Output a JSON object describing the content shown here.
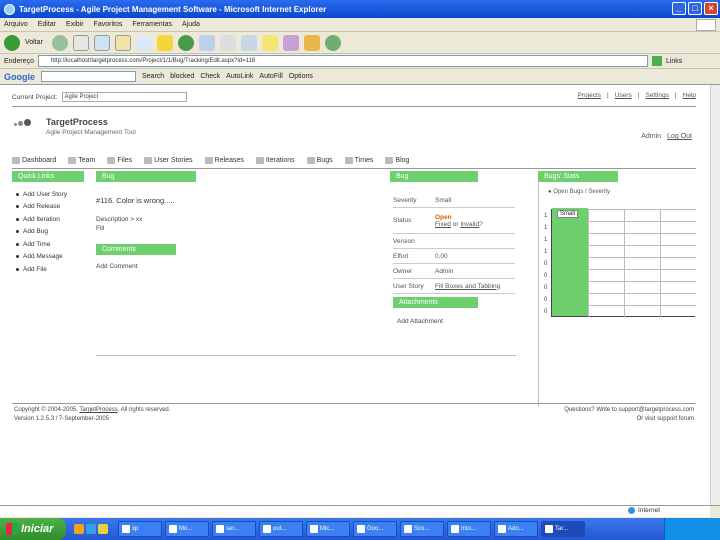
{
  "window": {
    "title": "TargetProcess - Agile Project Management Software - Microsoft Internet Explorer"
  },
  "menu": [
    "Arquivo",
    "Editar",
    "Exibir",
    "Favoritos",
    "Ferramentas",
    "Ajuda"
  ],
  "toolbar": {
    "back_label": "Voltar"
  },
  "address": {
    "label": "Endereço",
    "url": "http://localhost/targetprocess.com/Project/1/1/Bug/Tracking/Edit.aspx?id=116",
    "links_label": "Links"
  },
  "google": {
    "logo": "Google",
    "search_label": "Search",
    "popups_label": "blocked",
    "check_label": "Check",
    "autolink_label": "AutoLink",
    "autofill_label": "AutoFill",
    "options_label": "Options"
  },
  "project_bar": {
    "label": "Current Project:",
    "selected": "Agile Project"
  },
  "top_links": [
    "Projects",
    "Users",
    "Settings",
    "Help"
  ],
  "logo": {
    "name": "TargetProcess",
    "tagline": "Agile Project Management Tool"
  },
  "user": {
    "name": "Admin",
    "logout": "Log Out"
  },
  "nav": [
    "Dashboard",
    "Team",
    "Files",
    "User Stories",
    "Releases",
    "Iterations",
    "Bugs",
    "Times",
    "Blog"
  ],
  "quick_links": {
    "header": "Quick Links",
    "items": [
      "Add User Story",
      "Add Release",
      "Add Iteration",
      "Add Bug",
      "Add Time",
      "Add Message",
      "Add File"
    ]
  },
  "bug": {
    "header": "Bug",
    "title": "#116. Color is wrong.....",
    "description_line1": "Description > xx",
    "description_line2": "Fill",
    "comments_header": "Comments",
    "add_comment": "Add Comment"
  },
  "bug_props": {
    "header": "Bug",
    "severity_label": "Severity",
    "severity_value": "Small",
    "status_label": "Status",
    "status_value": "Open",
    "status_fixed": "Fixed",
    "status_or": "or",
    "status_invalid": "Invalid",
    "status_q": "?",
    "version_label": "Version",
    "effort_label": "Effort",
    "effort_value": "0.00",
    "owner_label": "Owner",
    "owner_value": "Admin",
    "story_label": "User Story",
    "story_value": "Fill Boxes and Tabbing",
    "attachments_header": "Attachments",
    "add_attachment": "Add Attachment"
  },
  "stats": {
    "header": "Bugs' Stats",
    "legend": "Open Bugs / Severity",
    "bar_label": "Small"
  },
  "chart_data": {
    "type": "bar",
    "categories": [
      "Small"
    ],
    "values": [
      1
    ],
    "ylim": [
      0,
      1
    ],
    "grid": true,
    "title": "",
    "xlabel": "",
    "ylabel": "",
    "yticks": [
      "1",
      "1",
      "1",
      "1",
      "0",
      "0",
      "0",
      "0",
      "0"
    ]
  },
  "footer": {
    "copyright": "Copyright © 2004-2005,",
    "company": "TargetProcess",
    "rights": ". All rights reserved.",
    "version": "Version 1.2.5.3 / 7-September-2005",
    "questions": "Questions? Write to support@targetprocess.com",
    "forum": "Or visit support forum"
  },
  "statusbar": {
    "zone": "Internet"
  },
  "taskbar": {
    "start": "Iniciar",
    "tasks": [
      "xp",
      "Mo...",
      "ser...",
      "out...",
      "Mic...",
      "Goo...",
      "Sco...",
      "Into...",
      "Ado...",
      "Tar..."
    ]
  },
  "colors": {
    "accent_green": "#6dcf6d",
    "title_blue": "#0b47c9",
    "open_orange": "#e05a00"
  }
}
